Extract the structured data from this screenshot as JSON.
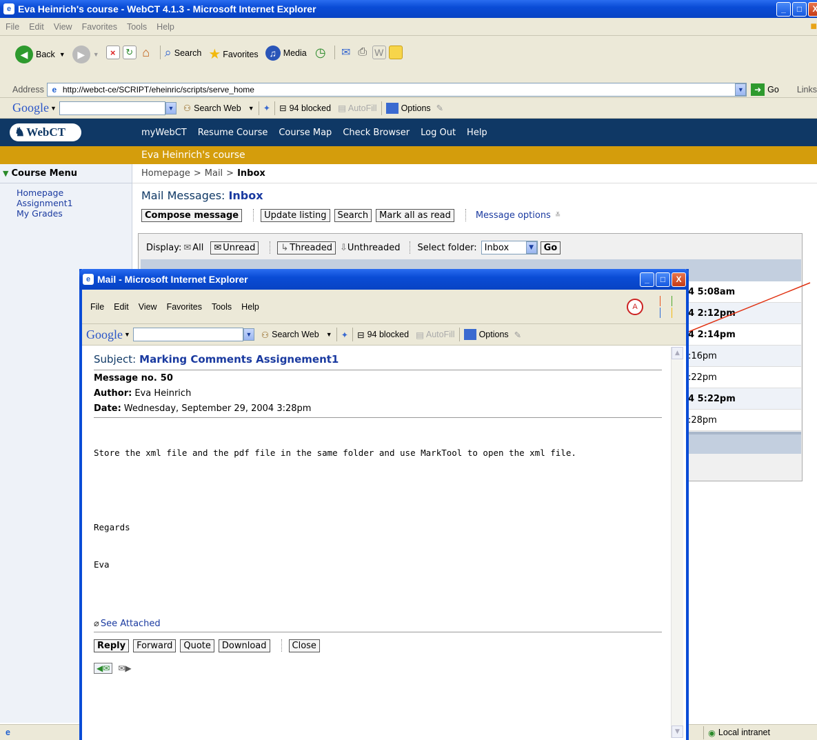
{
  "main_window": {
    "title": "Eva Heinrich's course - WebCT 4.1.3 - Microsoft Internet Explorer",
    "menu": [
      "File",
      "Edit",
      "View",
      "Favorites",
      "Tools",
      "Help"
    ],
    "toolbar": {
      "back": "Back",
      "search": "Search",
      "favorites": "Favorites",
      "media": "Media"
    },
    "address_label": "Address",
    "address_url": "http://webct-ce/SCRIPT/eheinric/scripts/serve_home",
    "go_label": "Go",
    "links_label": "Links",
    "google": {
      "logo": "Google",
      "search_web": "Search Web",
      "blocked": "94 blocked",
      "autofill": "AutoFill",
      "options": "Options"
    },
    "status_zone": "Local intranet"
  },
  "webct": {
    "logo": "WebCT",
    "nav": [
      "myWebCT",
      "Resume Course",
      "Course Map",
      "Check Browser",
      "Log Out",
      "Help"
    ],
    "course_title": "Eva Heinrich's course",
    "course_menu_label": "Course Menu",
    "course_menu": [
      "Homepage",
      "Assignment1",
      "My Grades"
    ],
    "breadcrumb": {
      "a": "Homepage",
      "sep": ">",
      "b": "Mail",
      "c": "Inbox"
    },
    "heading_prefix": "Mail Messages:",
    "heading_folder": "Inbox",
    "actions": {
      "compose": "Compose message",
      "update": "Update listing",
      "search": "Search",
      "mark_read": "Mark all as read",
      "options": "Message options"
    },
    "display": {
      "label": "Display:",
      "all": "All",
      "unread": "Unread",
      "threaded": "Threaded",
      "unthreaded": "Unthreaded",
      "select_folder": "Select folder:",
      "folder": "Inbox",
      "go": "Go"
    },
    "times": [
      "4 5:08am",
      "4 2:12pm",
      "4 2:14pm",
      ":16pm",
      ":22pm",
      "4 5:22pm",
      ":28pm"
    ]
  },
  "mail_window": {
    "title": "Mail - Microsoft Internet Explorer",
    "menu": [
      "File",
      "Edit",
      "View",
      "Favorites",
      "Tools",
      "Help"
    ],
    "google": {
      "logo": "Google",
      "search_web": "Search Web",
      "blocked": "94 blocked",
      "autofill": "AutoFill",
      "options": "Options"
    },
    "subject_label": "Subject:",
    "subject": "Marking Comments Assignement1",
    "msgno_label": "Message no.",
    "msgno": "50",
    "author_label": "Author:",
    "author": "Eva Heinrich",
    "date_label": "Date:",
    "date": "Wednesday, September 29, 2004 3:28pm",
    "body_line": "Store the xml file and the pdf file in the same folder and use MarkTool to open the xml file.",
    "regards": "Regards",
    "signoff": "Eva",
    "attachment": "See Attached",
    "buttons": {
      "reply": "Reply",
      "forward": "Forward",
      "quote": "Quote",
      "download": "Download",
      "close": "Close"
    }
  }
}
